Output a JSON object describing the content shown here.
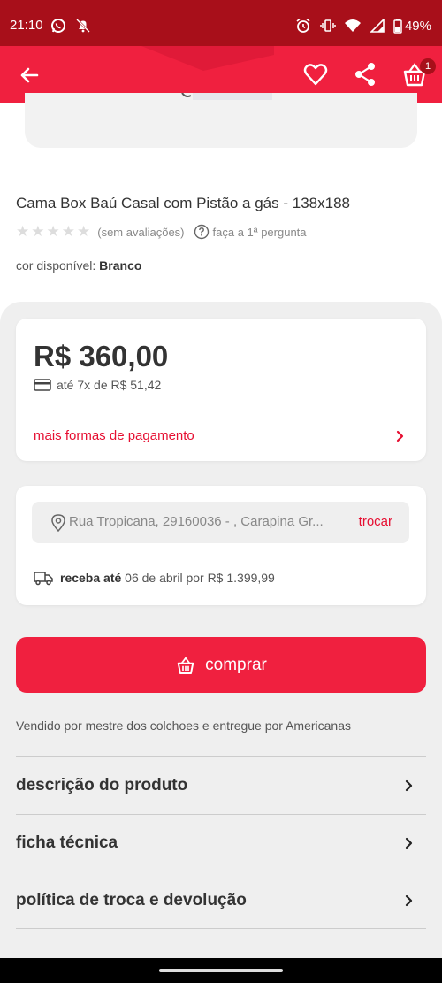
{
  "status_bar": {
    "time": "21:10",
    "battery": "49%",
    "icons": [
      "whatsapp-icon",
      "notifications-off-icon",
      "alarm-icon",
      "vibrate-icon",
      "wifi-icon",
      "signal-icon",
      "battery-icon"
    ]
  },
  "app_bar": {
    "icons": [
      "back-arrow-icon",
      "heart-icon",
      "share-icon",
      "basket-icon"
    ],
    "cart_count": "1"
  },
  "product": {
    "title": "Cama Box Baú Casal com Pistão a gás - 138x188",
    "rating_text": "(sem avaliações)",
    "question_text": "faça a 1ª pergunta",
    "color_label": "cor disponível:",
    "color_value": "Branco"
  },
  "price_card": {
    "price": "R$ 360,00",
    "installments": "até 7x de R$ 51,42",
    "more_payment": "mais formas de pagamento"
  },
  "shipping": {
    "address": "Rua Tropicana, 29160036 - , Carapina Gr...",
    "change": "trocar",
    "delivery_bold": "receba até",
    "delivery_rest": "06 de abril por R$ 1.399,99"
  },
  "buy_button": {
    "label": "comprar"
  },
  "seller_text": "Vendido por mestre dos colchoes e entregue por Americanas",
  "accordion": [
    {
      "label": "descrição do produto"
    },
    {
      "label": "ficha técnica"
    },
    {
      "label": "política de troca e devolução"
    }
  ],
  "colors": {
    "brand_red": "#f0203f",
    "status_red": "#a80f1a",
    "link_red": "#e60e31"
  }
}
